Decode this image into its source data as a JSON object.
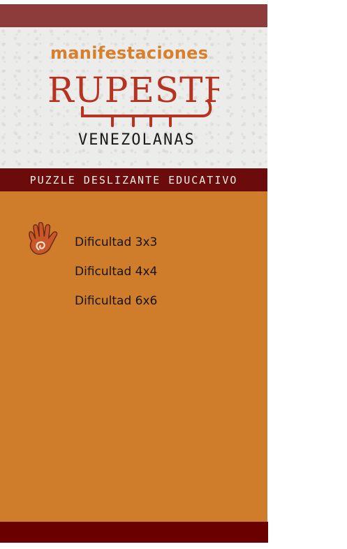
{
  "header": {
    "title_top": "manifestaciones",
    "title_main": "RUPESTRES",
    "title_bottom": "VENEZOLANAS"
  },
  "subtitle": "PUZZLE DESLIZANTE EDUCATIVO",
  "menu": {
    "items": [
      {
        "label": "Dificultad 3x3"
      },
      {
        "label": "Dificultad 4x4"
      },
      {
        "label": "Dificultad 6x6"
      }
    ]
  },
  "icons": {
    "hand": "hand-icon"
  },
  "colors": {
    "top_bar": "#8e3b3b",
    "subtitle_bar": "#6b0b0b",
    "main_bg": "#cf7c2b",
    "bottom_bar": "#6b0000",
    "title_orange": "#d97e2a",
    "title_red": "#b5331f"
  }
}
